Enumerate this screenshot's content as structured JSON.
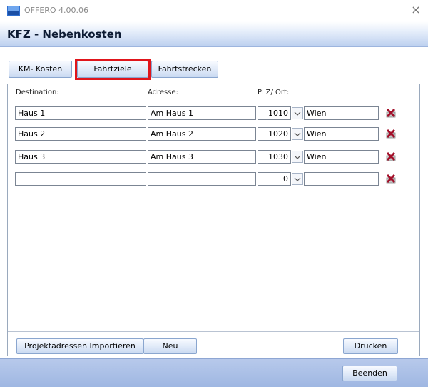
{
  "window": {
    "title": "OFFERO 4.00.06",
    "close_glyph": "×"
  },
  "header": {
    "title": "KFZ - Nebenkosten"
  },
  "tabs": [
    {
      "label": "KM- Kosten",
      "selected": false
    },
    {
      "label": "Fahrtziele",
      "selected": true
    },
    {
      "label": "Fahrtstrecken",
      "selected": false
    }
  ],
  "columns": {
    "destination": "Destination:",
    "address": "Adresse:",
    "plz_ort": "PLZ/ Ort:"
  },
  "rows": [
    {
      "destination": "Haus 1",
      "address": "Am Haus 1",
      "plz": "1010",
      "ort": "Wien"
    },
    {
      "destination": "Haus 2",
      "address": "Am Haus 2",
      "plz": "1020",
      "ort": "Wien"
    },
    {
      "destination": "Haus 3",
      "address": "Am Haus 3",
      "plz": "1030",
      "ort": "Wien"
    },
    {
      "destination": "",
      "address": "",
      "plz": "0",
      "ort": ""
    }
  ],
  "actions": {
    "import_label": "Projektadressen Importieren",
    "new_label": "Neu",
    "print_label": "Drucken"
  },
  "footer": {
    "close_label": "Beenden"
  },
  "icons": {
    "app": "offero-app-icon",
    "delete": "delete-row-icon",
    "dropdown": "chevron-down-icon"
  },
  "colors": {
    "header_gradient_bottom": "#bcd0ef",
    "footer_bg": "#9fb7e2",
    "highlight": "#e0151b",
    "delete_icon": "#a3102a"
  }
}
